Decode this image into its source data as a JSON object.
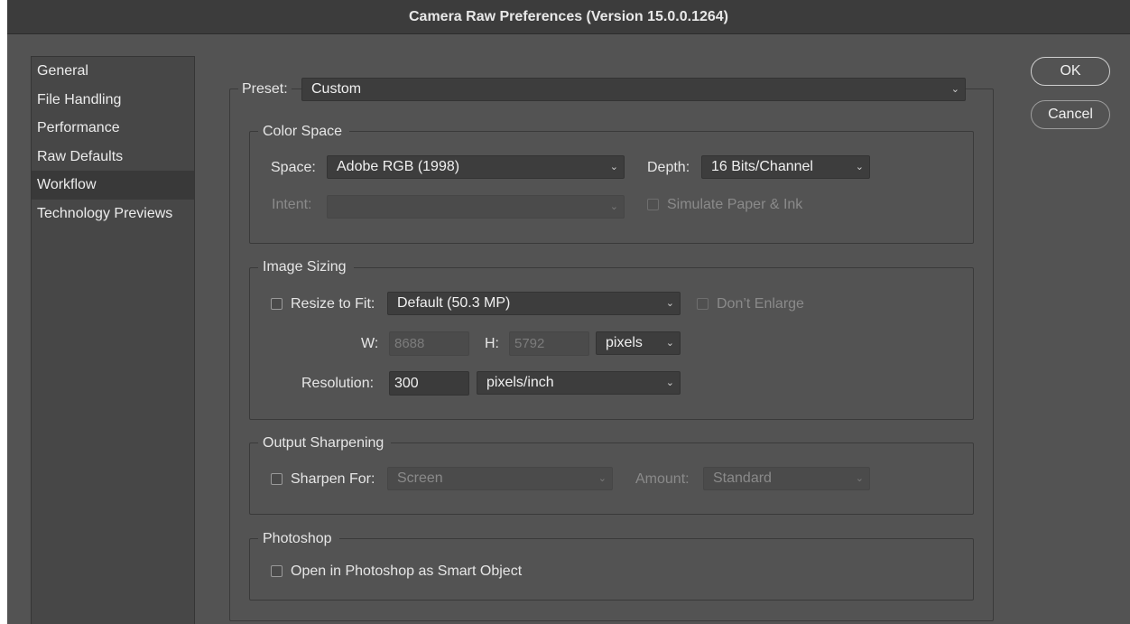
{
  "window": {
    "title": "Camera Raw Preferences  (Version 15.0.0.1264)"
  },
  "sidebar": {
    "items": [
      {
        "label": "General",
        "active": false
      },
      {
        "label": "File Handling",
        "active": false
      },
      {
        "label": "Performance",
        "active": false
      },
      {
        "label": "Raw Defaults",
        "active": false
      },
      {
        "label": "Workflow",
        "active": true
      },
      {
        "label": "Technology Previews",
        "active": false
      }
    ]
  },
  "preset": {
    "label": "Preset:",
    "value": "Custom"
  },
  "color_space": {
    "title": "Color Space",
    "space_label": "Space:",
    "space_value": "Adobe RGB (1998)",
    "depth_label": "Depth:",
    "depth_value": "16 Bits/Channel",
    "intent_label": "Intent:",
    "intent_value": "",
    "simulate_label": "Simulate Paper & Ink",
    "simulate_checked": false
  },
  "image_sizing": {
    "title": "Image Sizing",
    "resize_label": "Resize to Fit:",
    "resize_checked": false,
    "resize_value": "Default  (50.3 MP)",
    "dont_enlarge_label": "Don’t Enlarge",
    "w_label": "W:",
    "w_value": "8688",
    "h_label": "H:",
    "h_value": "5792",
    "unit_value": "pixels",
    "resolution_label": "Resolution:",
    "resolution_value": "300",
    "resolution_unit": "pixels/inch"
  },
  "output_sharpening": {
    "title": "Output Sharpening",
    "sharpen_label": "Sharpen For:",
    "sharpen_checked": false,
    "sharpen_value": "Screen",
    "amount_label": "Amount:",
    "amount_value": "Standard"
  },
  "photoshop": {
    "title": "Photoshop",
    "smart_object_label": "Open in Photoshop as Smart Object",
    "smart_object_checked": false
  },
  "buttons": {
    "ok": "OK",
    "cancel": "Cancel"
  },
  "icons": {
    "dropdown": "chevron-down-icon"
  },
  "colors": {
    "window_bg": "#535353",
    "titlebar_bg": "#3c3c3c",
    "sidebar_bg": "#474747",
    "sidebar_active_bg": "#393939",
    "field_bg": "#3d3d3d"
  }
}
